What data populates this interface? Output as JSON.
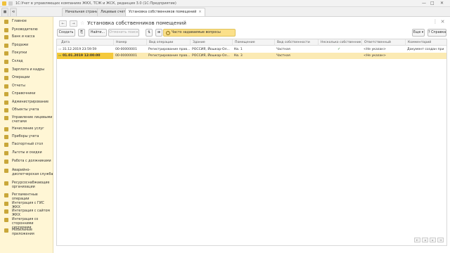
{
  "window": {
    "title": "1С:Учет в управляющих компаниях ЖКХ, ТСЖ и ЖСК, редакция 3.0 (1С:Предприятие)",
    "controls": [
      "—",
      "□",
      "✕"
    ]
  },
  "tabs": {
    "home": "Начальная страница",
    "t1": "Лицевые счета",
    "t2": "Установка собственников помещений",
    "close": "×"
  },
  "sidebar": {
    "items": [
      {
        "label": "Главное"
      },
      {
        "label": "Руководителю"
      },
      {
        "label": "Банк и касса"
      },
      {
        "label": "Продажи"
      },
      {
        "label": "Покупки"
      },
      {
        "label": "Склад"
      },
      {
        "label": "Зарплата и кадры"
      },
      {
        "label": "Операции"
      },
      {
        "label": "Отчеты"
      },
      {
        "label": "Справочники"
      },
      {
        "label": "Администрирование"
      },
      {
        "label": "Объекты учета"
      },
      {
        "label": "Управление лицевыми счетами"
      },
      {
        "label": "Начисление услуг"
      },
      {
        "label": "Приборы учета"
      },
      {
        "label": "Паспортный стол"
      },
      {
        "label": "Льготы и скидки"
      },
      {
        "label": "Работа с должниками"
      },
      {
        "label": "Аварийно-диспетчерская служба"
      },
      {
        "label": "Ресурсоснабжающие организации"
      },
      {
        "label": "Регламентные операции"
      },
      {
        "label": "Интеграция с ГИС ЖКХ"
      },
      {
        "label": "Интеграция с сайтом ЖКХ"
      },
      {
        "label": "Интеграция со сторонними системами"
      },
      {
        "label": "Мобильные приложения"
      }
    ]
  },
  "form": {
    "title": "Установка собственников помещений",
    "back": "←",
    "forward": "→",
    "star": "☆",
    "kebab": "⋮",
    "close": "✕"
  },
  "toolbar": {
    "create": "Создать",
    "find": "Найти...",
    "cancel_search": "Отменить поиск",
    "faq": "Часто задаваемые вопросы",
    "more": "Еще ▾",
    "help": "?  Справка"
  },
  "table": {
    "headers": [
      "Дата",
      "Номер",
      "Вид операции",
      "Здание",
      "Помещение",
      "Вид собственности",
      "Несколько собственников",
      "Ответственный",
      "Комментарий"
    ],
    "rows": [
      {
        "date": "31.12.2019 23:59:59",
        "number": "00-00000001",
        "op": "Регистрирование прав...",
        "building": "РОССИЯ, Йошкар-Ол...",
        "room": "Кв. 1",
        "kind": "Частная",
        "multi": "✓",
        "resp": "<Не указан>",
        "comment": "Документ создан при"
      },
      {
        "date": "01.01.2019 12:00:00",
        "number": "00-00000001",
        "op": "Регистрирование прав...",
        "building": "РОССИЯ, Йошкар-Ол...",
        "room": "Кв. 3",
        "kind": "Частная",
        "multi": "",
        "resp": "<Не указан>",
        "comment": ""
      }
    ]
  },
  "pager": [
    "⇤",
    "◂",
    "▸",
    "⇥"
  ],
  "colors": {
    "sidebar_bg": "#fff6d5",
    "accent": "#f4c93b",
    "selected_row": "#fbeab3"
  }
}
